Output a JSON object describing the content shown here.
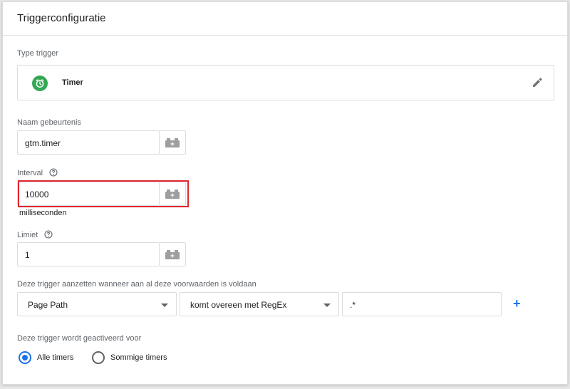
{
  "panel": {
    "title": "Triggerconfiguratie"
  },
  "trigger_type": {
    "label": "Type trigger",
    "name": "Timer",
    "icon": "alarm-clock-icon",
    "badge_color": "#34a853"
  },
  "event_name": {
    "label": "Naam gebeurtenis",
    "value": "gtm.timer"
  },
  "interval": {
    "label": "Interval",
    "value": "10000",
    "unit": "milliseconden"
  },
  "limit": {
    "label": "Limiet",
    "value": "1"
  },
  "condition": {
    "label": "Deze trigger aanzetten wanneer aan al deze voorwaarden is voldaan",
    "variable": "Page Path",
    "operator": "komt overeen met RegEx",
    "value": ".*",
    "add_label": "+"
  },
  "activation": {
    "label": "Deze trigger wordt geactiveerd voor",
    "options": [
      {
        "label": "Alle timers",
        "selected": true
      },
      {
        "label": "Sommige timers",
        "selected": false
      }
    ]
  },
  "colors": {
    "accent": "#1a73e8",
    "highlight": "#e0272e"
  }
}
